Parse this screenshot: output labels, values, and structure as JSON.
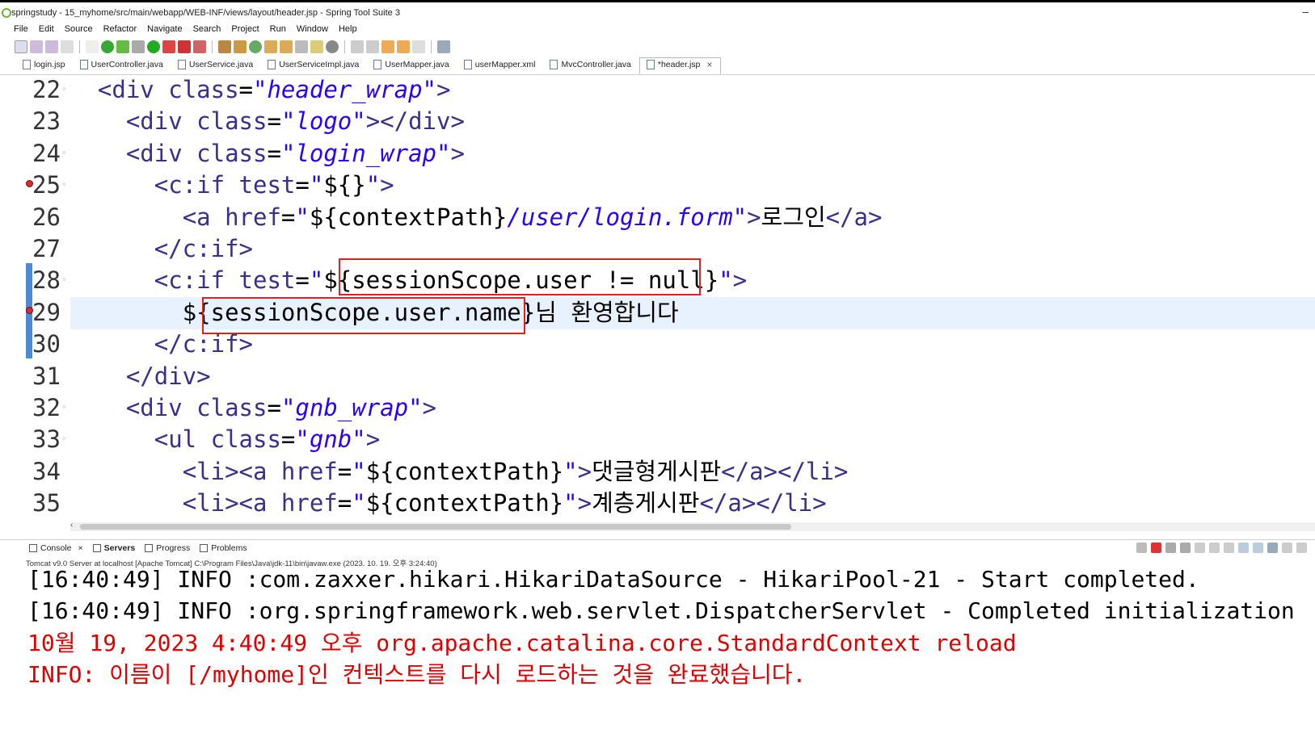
{
  "window": {
    "title": "springstudy - 15_myhome/src/main/webapp/WEB-INF/views/layout/header.jsp - Spring Tool Suite 3"
  },
  "menu": [
    "File",
    "Edit",
    "Source",
    "Refactor",
    "Navigate",
    "Search",
    "Project",
    "Run",
    "Window",
    "Help"
  ],
  "tabs": [
    {
      "label": "login.jsp"
    },
    {
      "label": "UserController.java"
    },
    {
      "label": "UserService.java"
    },
    {
      "label": "UserServiceImpl.java"
    },
    {
      "label": "UserMapper.java"
    },
    {
      "label": "userMapper.xml"
    },
    {
      "label": "MvcController.java"
    },
    {
      "label": "*header.jsp"
    }
  ],
  "editor": {
    "lines": [
      {
        "num": "22",
        "indent": "  ",
        "parts": [
          [
            "tag",
            "<div "
          ],
          [
            "attr",
            "class"
          ],
          [
            "plain",
            "="
          ],
          [
            "str",
            "\"header_wrap\""
          ],
          [
            "tag",
            ">"
          ]
        ]
      },
      {
        "num": "23",
        "indent": "    ",
        "parts": [
          [
            "tag",
            "<div "
          ],
          [
            "attr",
            "class"
          ],
          [
            "plain",
            "="
          ],
          [
            "str",
            "\"logo\""
          ],
          [
            "tag",
            "></div>"
          ]
        ]
      },
      {
        "num": "24",
        "indent": "    ",
        "parts": [
          [
            "tag",
            "<div "
          ],
          [
            "attr",
            "class"
          ],
          [
            "plain",
            "="
          ],
          [
            "str",
            "\"login_wrap\""
          ],
          [
            "tag",
            ">"
          ]
        ]
      },
      {
        "num": "25",
        "indent": "      ",
        "parts": [
          [
            "tag",
            "<c:if "
          ],
          [
            "attr",
            "test"
          ],
          [
            "plain",
            "="
          ],
          [
            "str",
            "\""
          ],
          [
            "plain",
            "${}"
          ],
          [
            "str",
            "\""
          ],
          [
            "tag",
            ">"
          ]
        ]
      },
      {
        "num": "26",
        "indent": "        ",
        "parts": [
          [
            "tag",
            "<a "
          ],
          [
            "attr",
            "href"
          ],
          [
            "plain",
            "="
          ],
          [
            "str",
            "\""
          ],
          [
            "plain",
            "${contextPath}"
          ],
          [
            "str",
            "/user/login.form\""
          ],
          [
            "tag",
            ">"
          ],
          [
            "plain",
            "로그인"
          ],
          [
            "tag",
            "</a>"
          ]
        ]
      },
      {
        "num": "27",
        "indent": "      ",
        "parts": [
          [
            "tag",
            "</c:if>"
          ]
        ]
      },
      {
        "num": "28",
        "indent": "      ",
        "parts": [
          [
            "tag",
            "<c:if "
          ],
          [
            "attr",
            "test"
          ],
          [
            "plain",
            "="
          ],
          [
            "str",
            "\""
          ],
          [
            "plain",
            "${sessionScope.user != null}"
          ],
          [
            "str",
            "\""
          ],
          [
            "tag",
            ">"
          ]
        ]
      },
      {
        "num": "29",
        "indent": "        ",
        "parts": [
          [
            "plain",
            "${sessionScope.user.name}님 환영합니다"
          ]
        ]
      },
      {
        "num": "30",
        "indent": "      ",
        "parts": [
          [
            "tag",
            "</c:if>"
          ]
        ]
      },
      {
        "num": "31",
        "indent": "    ",
        "parts": [
          [
            "tag",
            "</div>"
          ]
        ]
      },
      {
        "num": "32",
        "indent": "    ",
        "parts": [
          [
            "tag",
            "<div "
          ],
          [
            "attr",
            "class"
          ],
          [
            "plain",
            "="
          ],
          [
            "str",
            "\"gnb_wrap\""
          ],
          [
            "tag",
            ">"
          ]
        ]
      },
      {
        "num": "33",
        "indent": "      ",
        "parts": [
          [
            "tag",
            "<ul "
          ],
          [
            "attr",
            "class"
          ],
          [
            "plain",
            "="
          ],
          [
            "str",
            "\"gnb\""
          ],
          [
            "tag",
            ">"
          ]
        ]
      },
      {
        "num": "34",
        "indent": "        ",
        "parts": [
          [
            "tag",
            "<li><a "
          ],
          [
            "attr",
            "href"
          ],
          [
            "plain",
            "="
          ],
          [
            "str",
            "\""
          ],
          [
            "plain",
            "${contextPath}"
          ],
          [
            "str",
            "\""
          ],
          [
            "tag",
            ">"
          ],
          [
            "plain",
            "댓글형게시판"
          ],
          [
            "tag",
            "</a></li>"
          ]
        ]
      },
      {
        "num": "35",
        "indent": "        ",
        "parts": [
          [
            "tag",
            "<li><a "
          ],
          [
            "attr",
            "href"
          ],
          [
            "plain",
            "="
          ],
          [
            "str",
            "\""
          ],
          [
            "plain",
            "${contextPath}"
          ],
          [
            "str",
            "\""
          ],
          [
            "tag",
            ">"
          ],
          [
            "plain",
            "계층게시판"
          ],
          [
            "tag",
            "</a></li>"
          ]
        ]
      }
    ]
  },
  "console": {
    "tabs": [
      {
        "label": "Console"
      },
      {
        "label": "Servers"
      },
      {
        "label": "Progress"
      },
      {
        "label": "Problems"
      }
    ],
    "server_info": "Tomcat v9.0 Server at localhost [Apache Tomcat] C:\\Program Files\\Java\\jdk-11\\bin\\javaw.exe  (2023. 10. 19. 오후 3:24:40)",
    "lines": [
      {
        "type": "info",
        "text": "[16:40:49] INFO :com.zaxxer.hikari.HikariDataSource - HikariPool-21 - Start completed."
      },
      {
        "type": "info",
        "text": "[16:40:49] INFO :org.springframework.web.servlet.DispatcherServlet - Completed initialization"
      },
      {
        "type": "red",
        "text": "10월 19, 2023 4:40:49 오후 org.apache.catalina.core.StandardContext reload"
      },
      {
        "type": "red",
        "text": "INFO: 이름이 [/myhome]인 컨텍스트를 다시 로드하는 것을 완료했습니다."
      }
    ]
  },
  "colors": {
    "tag": "#3a2e8f",
    "string": "#2a00ff",
    "highlight_box": "#e02020",
    "console_error": "#e00000"
  }
}
